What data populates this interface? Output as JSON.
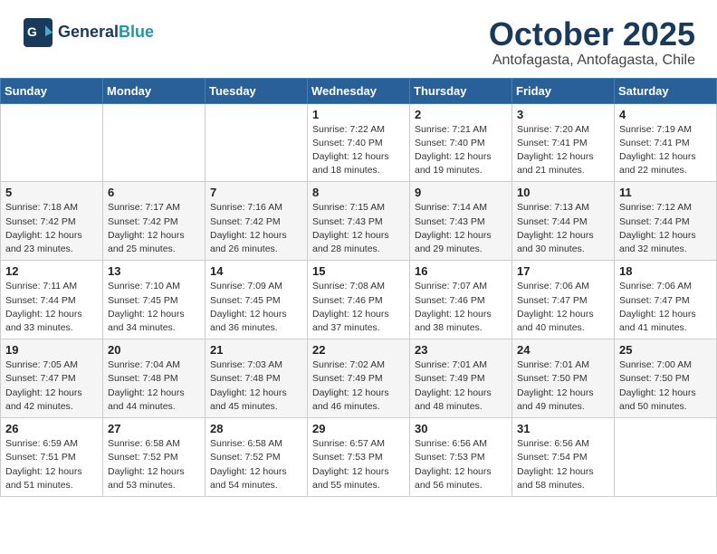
{
  "header": {
    "logo_general": "General",
    "logo_blue": "Blue",
    "month": "October 2025",
    "location": "Antofagasta, Antofagasta, Chile"
  },
  "weekdays": [
    "Sunday",
    "Monday",
    "Tuesday",
    "Wednesday",
    "Thursday",
    "Friday",
    "Saturday"
  ],
  "weeks": [
    [
      {
        "day": "",
        "info": ""
      },
      {
        "day": "",
        "info": ""
      },
      {
        "day": "",
        "info": ""
      },
      {
        "day": "1",
        "info": "Sunrise: 7:22 AM\nSunset: 7:40 PM\nDaylight: 12 hours and 18 minutes."
      },
      {
        "day": "2",
        "info": "Sunrise: 7:21 AM\nSunset: 7:40 PM\nDaylight: 12 hours and 19 minutes."
      },
      {
        "day": "3",
        "info": "Sunrise: 7:20 AM\nSunset: 7:41 PM\nDaylight: 12 hours and 21 minutes."
      },
      {
        "day": "4",
        "info": "Sunrise: 7:19 AM\nSunset: 7:41 PM\nDaylight: 12 hours and 22 minutes."
      }
    ],
    [
      {
        "day": "5",
        "info": "Sunrise: 7:18 AM\nSunset: 7:42 PM\nDaylight: 12 hours and 23 minutes."
      },
      {
        "day": "6",
        "info": "Sunrise: 7:17 AM\nSunset: 7:42 PM\nDaylight: 12 hours and 25 minutes."
      },
      {
        "day": "7",
        "info": "Sunrise: 7:16 AM\nSunset: 7:42 PM\nDaylight: 12 hours and 26 minutes."
      },
      {
        "day": "8",
        "info": "Sunrise: 7:15 AM\nSunset: 7:43 PM\nDaylight: 12 hours and 28 minutes."
      },
      {
        "day": "9",
        "info": "Sunrise: 7:14 AM\nSunset: 7:43 PM\nDaylight: 12 hours and 29 minutes."
      },
      {
        "day": "10",
        "info": "Sunrise: 7:13 AM\nSunset: 7:44 PM\nDaylight: 12 hours and 30 minutes."
      },
      {
        "day": "11",
        "info": "Sunrise: 7:12 AM\nSunset: 7:44 PM\nDaylight: 12 hours and 32 minutes."
      }
    ],
    [
      {
        "day": "12",
        "info": "Sunrise: 7:11 AM\nSunset: 7:44 PM\nDaylight: 12 hours and 33 minutes."
      },
      {
        "day": "13",
        "info": "Sunrise: 7:10 AM\nSunset: 7:45 PM\nDaylight: 12 hours and 34 minutes."
      },
      {
        "day": "14",
        "info": "Sunrise: 7:09 AM\nSunset: 7:45 PM\nDaylight: 12 hours and 36 minutes."
      },
      {
        "day": "15",
        "info": "Sunrise: 7:08 AM\nSunset: 7:46 PM\nDaylight: 12 hours and 37 minutes."
      },
      {
        "day": "16",
        "info": "Sunrise: 7:07 AM\nSunset: 7:46 PM\nDaylight: 12 hours and 38 minutes."
      },
      {
        "day": "17",
        "info": "Sunrise: 7:06 AM\nSunset: 7:47 PM\nDaylight: 12 hours and 40 minutes."
      },
      {
        "day": "18",
        "info": "Sunrise: 7:06 AM\nSunset: 7:47 PM\nDaylight: 12 hours and 41 minutes."
      }
    ],
    [
      {
        "day": "19",
        "info": "Sunrise: 7:05 AM\nSunset: 7:47 PM\nDaylight: 12 hours and 42 minutes."
      },
      {
        "day": "20",
        "info": "Sunrise: 7:04 AM\nSunset: 7:48 PM\nDaylight: 12 hours and 44 minutes."
      },
      {
        "day": "21",
        "info": "Sunrise: 7:03 AM\nSunset: 7:48 PM\nDaylight: 12 hours and 45 minutes."
      },
      {
        "day": "22",
        "info": "Sunrise: 7:02 AM\nSunset: 7:49 PM\nDaylight: 12 hours and 46 minutes."
      },
      {
        "day": "23",
        "info": "Sunrise: 7:01 AM\nSunset: 7:49 PM\nDaylight: 12 hours and 48 minutes."
      },
      {
        "day": "24",
        "info": "Sunrise: 7:01 AM\nSunset: 7:50 PM\nDaylight: 12 hours and 49 minutes."
      },
      {
        "day": "25",
        "info": "Sunrise: 7:00 AM\nSunset: 7:50 PM\nDaylight: 12 hours and 50 minutes."
      }
    ],
    [
      {
        "day": "26",
        "info": "Sunrise: 6:59 AM\nSunset: 7:51 PM\nDaylight: 12 hours and 51 minutes."
      },
      {
        "day": "27",
        "info": "Sunrise: 6:58 AM\nSunset: 7:52 PM\nDaylight: 12 hours and 53 minutes."
      },
      {
        "day": "28",
        "info": "Sunrise: 6:58 AM\nSunset: 7:52 PM\nDaylight: 12 hours and 54 minutes."
      },
      {
        "day": "29",
        "info": "Sunrise: 6:57 AM\nSunset: 7:53 PM\nDaylight: 12 hours and 55 minutes."
      },
      {
        "day": "30",
        "info": "Sunrise: 6:56 AM\nSunset: 7:53 PM\nDaylight: 12 hours and 56 minutes."
      },
      {
        "day": "31",
        "info": "Sunrise: 6:56 AM\nSunset: 7:54 PM\nDaylight: 12 hours and 58 minutes."
      },
      {
        "day": "",
        "info": ""
      }
    ]
  ]
}
